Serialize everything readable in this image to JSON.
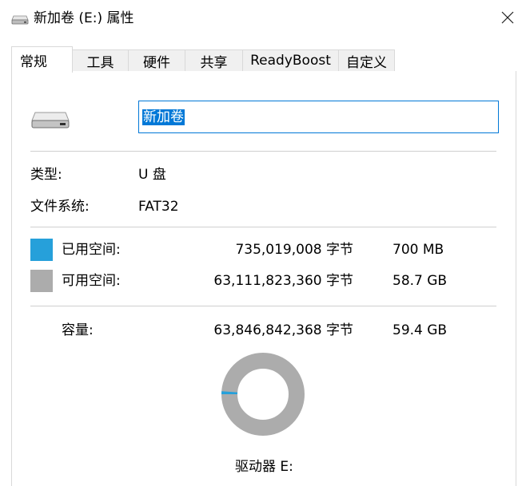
{
  "window": {
    "title": "新加卷 (E:) 属性",
    "title_icon": "drive-icon",
    "close_icon": "close-icon"
  },
  "tabs": [
    {
      "label": "常规",
      "active": true
    },
    {
      "label": "工具",
      "active": false
    },
    {
      "label": "硬件",
      "active": false
    },
    {
      "label": "共享",
      "active": false
    },
    {
      "label": "ReadyBoost",
      "active": false
    },
    {
      "label": "自定义",
      "active": false
    }
  ],
  "general": {
    "volume_name": "新加卷",
    "type_label": "类型:",
    "type_value": "U 盘",
    "fs_label": "文件系统:",
    "fs_value": "FAT32",
    "used_label": "已用空间:",
    "used_bytes": "735,019,008 字节",
    "used_size": "700 MB",
    "free_label": "可用空间:",
    "free_bytes": "63,111,823,360 字节",
    "free_size": "58.7 GB",
    "capacity_label": "容量:",
    "capacity_bytes": "63,846,842,368 字节",
    "capacity_size": "59.4 GB",
    "drive_label": "驱动器 E:"
  },
  "colors": {
    "used": "#26a0da",
    "free": "#acacac",
    "selection": "#0078d7"
  },
  "chart_data": {
    "type": "pie",
    "categories": [
      "已用空间",
      "可用空间"
    ],
    "values": [
      735019008,
      63111823360
    ]
  }
}
